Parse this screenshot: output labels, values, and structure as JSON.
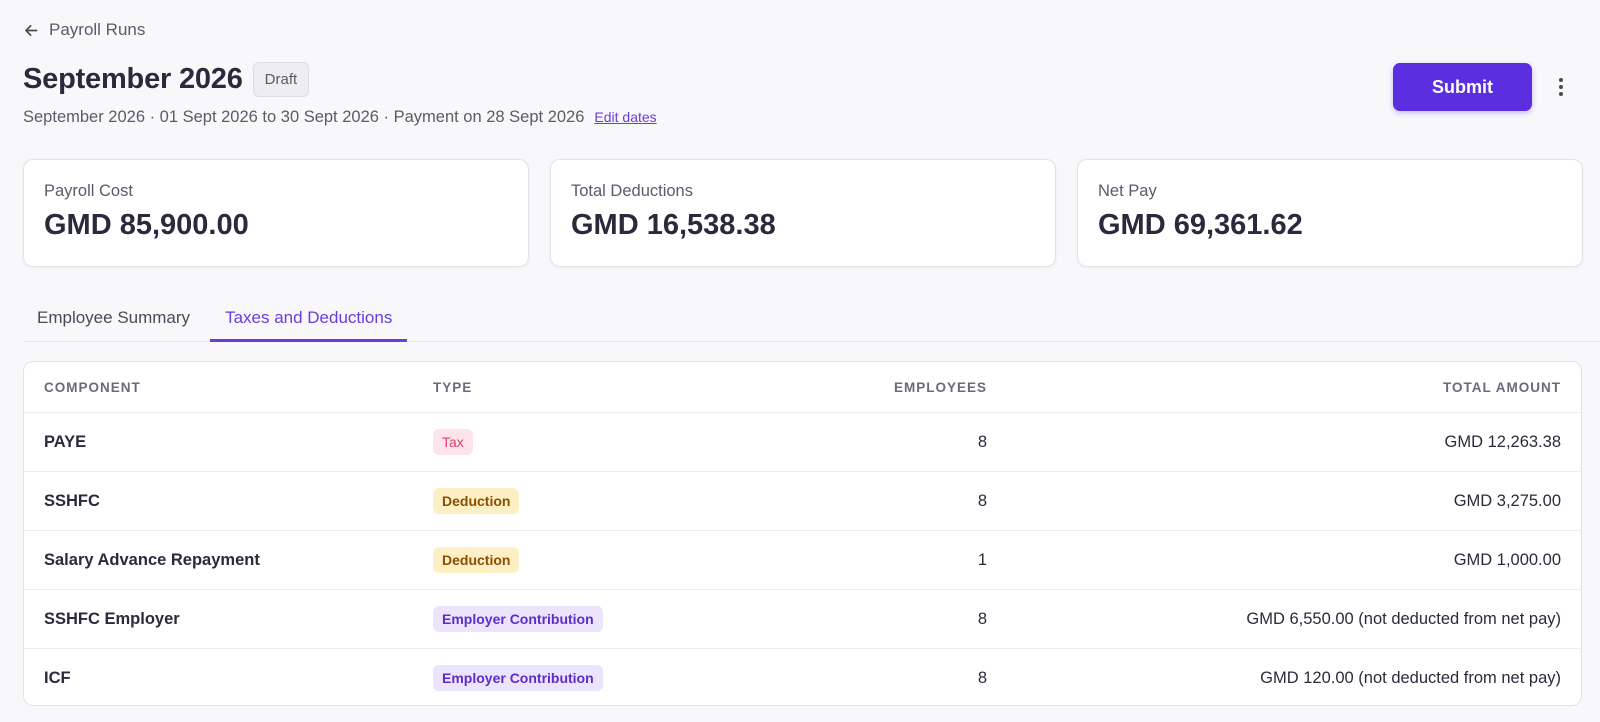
{
  "nav": {
    "back_label": "Payroll Runs"
  },
  "header": {
    "title": "September 2026",
    "status": "Draft",
    "subtitle": "September 2026 · 01 Sept 2026 to 30 Sept 2026 · Payment on 28 Sept 2026",
    "edit_dates": "Edit dates",
    "submit_label": "Submit"
  },
  "summary": [
    {
      "label": "Payroll Cost",
      "value": "GMD 85,900.00"
    },
    {
      "label": "Total Deductions",
      "value": "GMD 16,538.38"
    },
    {
      "label": "Net Pay",
      "value": "GMD 69,361.62"
    }
  ],
  "tabs": [
    {
      "label": "Employee Summary",
      "active": false
    },
    {
      "label": "Taxes and Deductions",
      "active": true
    }
  ],
  "table": {
    "headers": [
      "COMPONENT",
      "TYPE",
      "EMPLOYEES",
      "TOTAL AMOUNT"
    ],
    "rows": [
      {
        "component": "PAYE",
        "type": "Tax",
        "employees": "8",
        "amount": "GMD 12,263.38"
      },
      {
        "component": "SSHFC",
        "type": "Deduction",
        "employees": "8",
        "amount": "GMD 3,275.00"
      },
      {
        "component": "Salary Advance Repayment",
        "type": "Deduction",
        "employees": "1",
        "amount": "GMD 1,000.00"
      },
      {
        "component": "SSHFC Employer",
        "type": "Employer Contribution",
        "employees": "8",
        "amount": "GMD 6,550.00 (not deducted from net pay)"
      },
      {
        "component": "ICF",
        "type": "Employer Contribution",
        "employees": "8",
        "amount": "GMD 120.00 (not deducted from net pay)"
      }
    ]
  },
  "colors": {
    "accent": "#5b2ee0",
    "tax_badge": "#fde4ec",
    "deduction_badge": "#fdefc4",
    "employer_badge": "#ece4fd"
  },
  "icons": {
    "back": "arrow-left-icon",
    "more": "more-vertical-icon"
  }
}
